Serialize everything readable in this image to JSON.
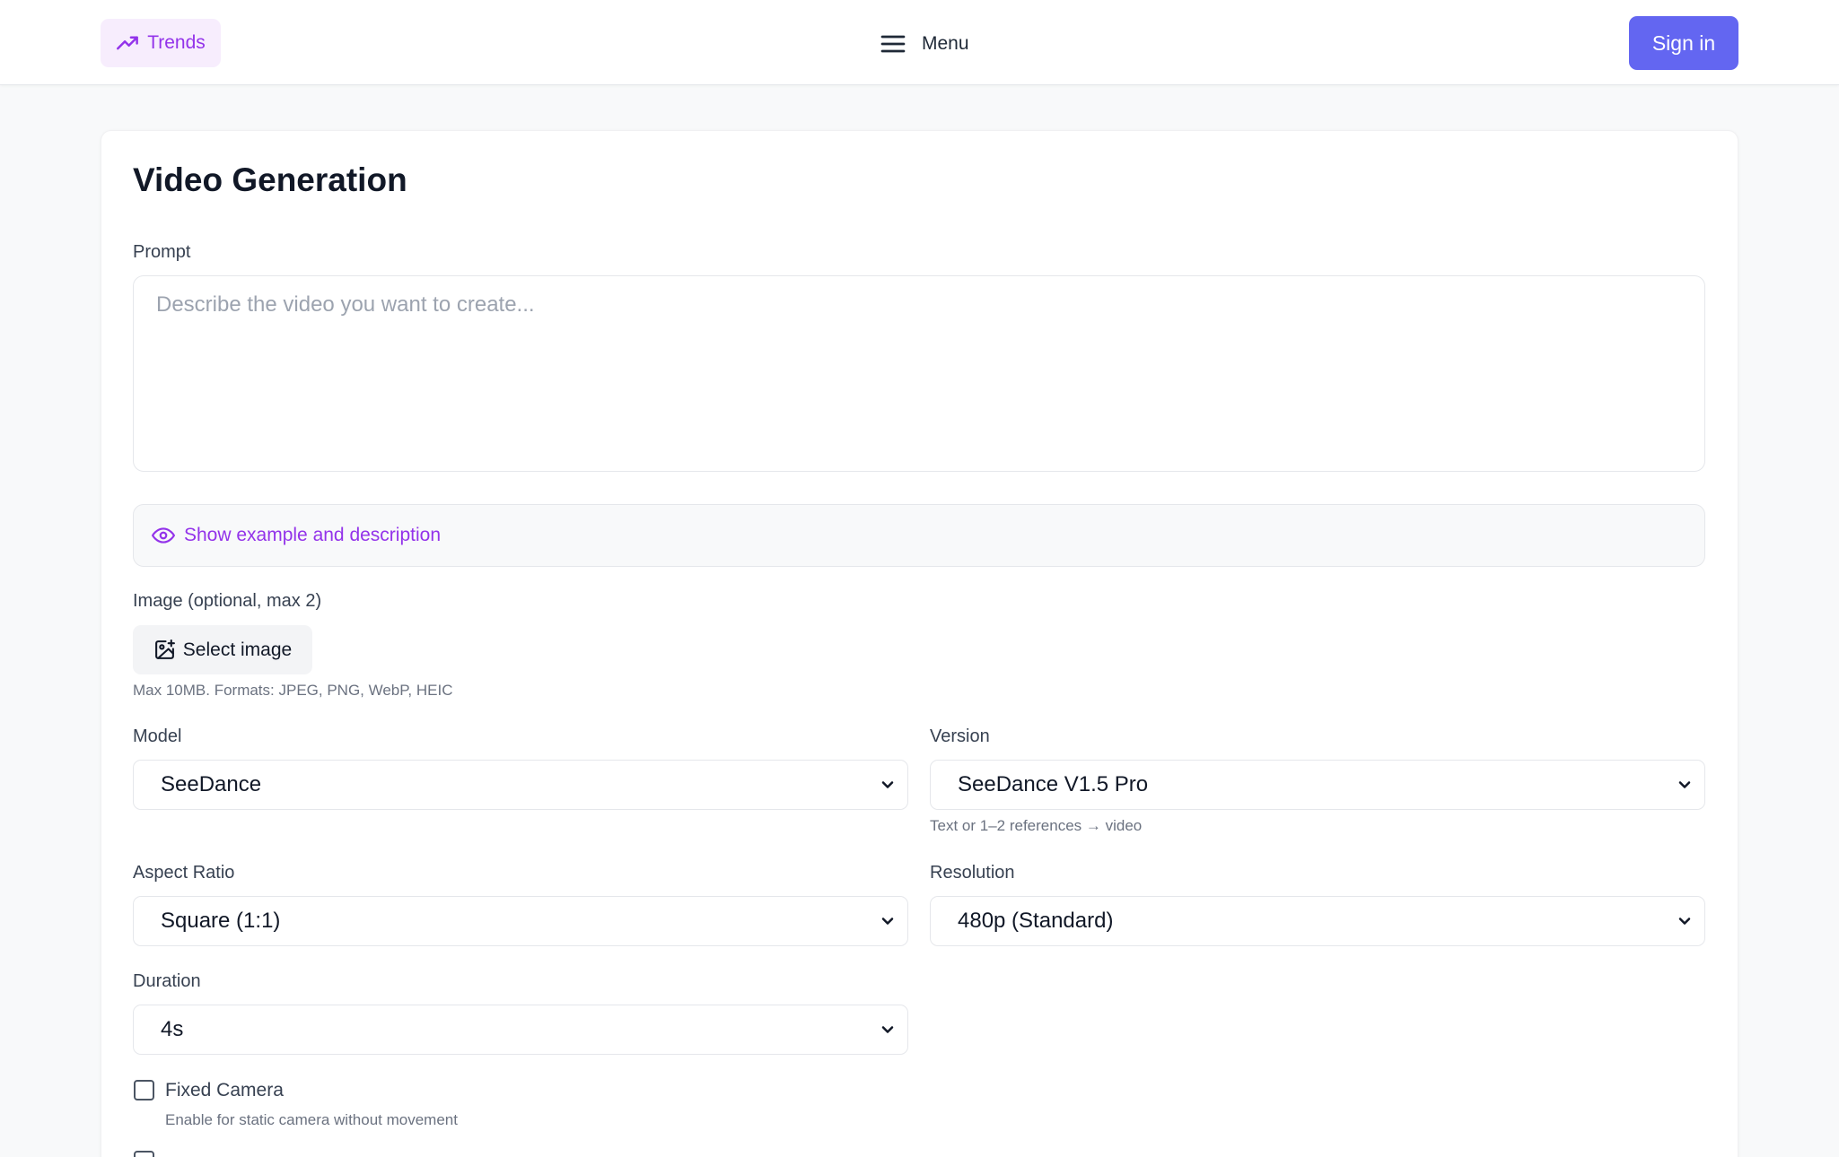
{
  "header": {
    "trends_label": "Trends",
    "menu_label": "Menu",
    "signin_label": "Sign in"
  },
  "page": {
    "title": "Video Generation"
  },
  "prompt": {
    "label": "Prompt",
    "placeholder": "Describe the video you want to create...",
    "value": ""
  },
  "example_toggle": {
    "label": "Show example and description"
  },
  "image": {
    "label": "Image (optional, max 2)",
    "button_label": "Select image",
    "hint": "Max 10MB. Formats: JPEG, PNG, WebP, HEIC"
  },
  "model": {
    "label": "Model",
    "selected": "SeeDance"
  },
  "version": {
    "label": "Version",
    "selected": "SeeDance V1.5 Pro",
    "hint": "Text or 1–2 references → video"
  },
  "aspect_ratio": {
    "label": "Aspect Ratio",
    "selected": "Square (1:1)"
  },
  "resolution": {
    "label": "Resolution",
    "selected": "480p (Standard)"
  },
  "duration": {
    "label": "Duration",
    "selected": "4s"
  },
  "fixed_camera": {
    "label": "Fixed Camera",
    "hint": "Enable for static camera without movement",
    "checked": false
  },
  "colors": {
    "accent_purple": "#9333ea",
    "signin_bg": "#6366f1",
    "trends_bg": "#f7edfd"
  }
}
